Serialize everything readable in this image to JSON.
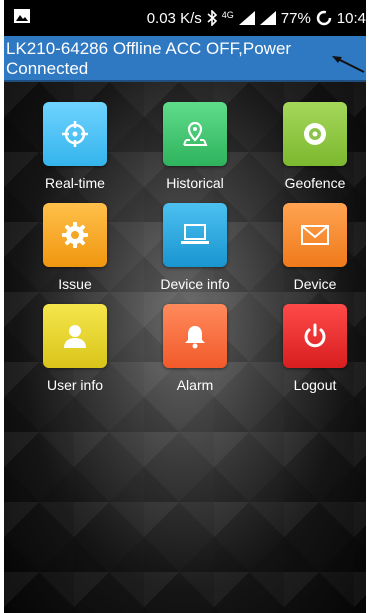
{
  "status_bar": {
    "speed": "0.03 K/s",
    "network": "4G",
    "battery": "77%",
    "time": "10:4",
    "icons": [
      "image-icon",
      "bluetooth-icon",
      "signal-icon",
      "signal-icon",
      "sync-icon"
    ]
  },
  "banner": {
    "text": "LK210-64286 Offline ACC OFF,Power Connected",
    "colors": {
      "background": "#2f78c2"
    }
  },
  "menu": {
    "items": [
      {
        "label": "Real-time",
        "icon": "crosshair-icon",
        "color": "#4fc3f7"
      },
      {
        "label": "Historical",
        "icon": "map-pin-icon",
        "color": "#43c66e"
      },
      {
        "label": "Geofence",
        "icon": "target-icon",
        "color": "#8bc34a"
      },
      {
        "label": "Issue",
        "icon": "gear-icon",
        "color": "#f5a623"
      },
      {
        "label": "Device info",
        "icon": "laptop-icon",
        "color": "#29a9e0"
      },
      {
        "label": "Device",
        "icon": "envelope-icon",
        "color": "#f58a2e"
      },
      {
        "label": "User info",
        "icon": "user-icon",
        "color": "#e8d62f"
      },
      {
        "label": "Alarm",
        "icon": "bell-icon",
        "color": "#ff7043"
      },
      {
        "label": "Logout",
        "icon": "power-icon",
        "color": "#e53935"
      }
    ]
  }
}
